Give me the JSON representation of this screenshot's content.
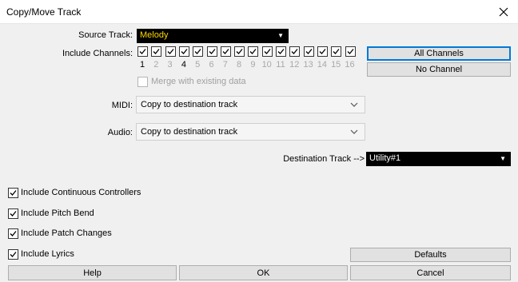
{
  "window": {
    "title": "Copy/Move Track"
  },
  "source_track": {
    "label": "Source Track:",
    "value": "Melody"
  },
  "include_channels": {
    "label": "Include Channels:",
    "channels": [
      {
        "num": "1",
        "checked": true,
        "active": true
      },
      {
        "num": "2",
        "checked": true,
        "active": false
      },
      {
        "num": "3",
        "checked": true,
        "active": false
      },
      {
        "num": "4",
        "checked": true,
        "active": true
      },
      {
        "num": "5",
        "checked": true,
        "active": false
      },
      {
        "num": "6",
        "checked": true,
        "active": false
      },
      {
        "num": "7",
        "checked": true,
        "active": false
      },
      {
        "num": "8",
        "checked": true,
        "active": false
      },
      {
        "num": "9",
        "checked": true,
        "active": false
      },
      {
        "num": "10",
        "checked": true,
        "active": false
      },
      {
        "num": "11",
        "checked": true,
        "active": false
      },
      {
        "num": "12",
        "checked": true,
        "active": false
      },
      {
        "num": "13",
        "checked": true,
        "active": false
      },
      {
        "num": "14",
        "checked": true,
        "active": false
      },
      {
        "num": "15",
        "checked": true,
        "active": false
      },
      {
        "num": "16",
        "checked": true,
        "active": false
      }
    ]
  },
  "merge": {
    "label": "Merge with existing data",
    "checked": false,
    "enabled": false
  },
  "buttons": {
    "all_channels": "All Channels",
    "no_channel": "No Channel",
    "defaults": "Defaults",
    "help": "Help",
    "ok": "OK",
    "cancel": "Cancel"
  },
  "midi": {
    "label": "MIDI:",
    "value": "Copy to destination track"
  },
  "audio": {
    "label": "Audio:",
    "value": "Copy to destination track"
  },
  "destination_track": {
    "label": "Destination Track -->",
    "value": "Utility#1"
  },
  "options": [
    {
      "label": "Include Continuous Controllers",
      "checked": true
    },
    {
      "label": "Include Pitch Bend",
      "checked": true
    },
    {
      "label": "Include Patch Changes",
      "checked": true
    },
    {
      "label": "Include Lyrics",
      "checked": true
    }
  ],
  "colors": {
    "dialog_bg": "#f0f0f0",
    "dark_select_bg": "#000000",
    "dark_select_text": "#ffd700",
    "focus_border": "#0078d7"
  }
}
